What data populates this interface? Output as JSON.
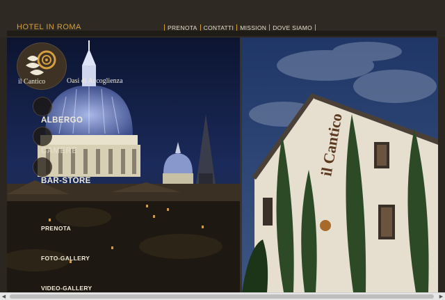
{
  "header": {
    "site_title": "HOTEL IN ROMA",
    "nav": [
      "PRENOTA",
      "CONTATTI",
      "MISSION",
      "DOVE SIAMO"
    ]
  },
  "brand": {
    "logo_name": "il Cantico",
    "tagline": "Oasi di Accoglienza",
    "accent": "#d6a040"
  },
  "side_menu": {
    "main": [
      "ALBERGO",
      "CAMERE",
      "BAR-STORE"
    ],
    "secondary": [
      "PRENOTA",
      "FOTO-GALLERY",
      "VIDEO-GALLERY"
    ]
  },
  "photos": {
    "left": "rome-night-dome-photo",
    "right": "hotel-facade-photo",
    "facade_sign": "il Cantico"
  }
}
